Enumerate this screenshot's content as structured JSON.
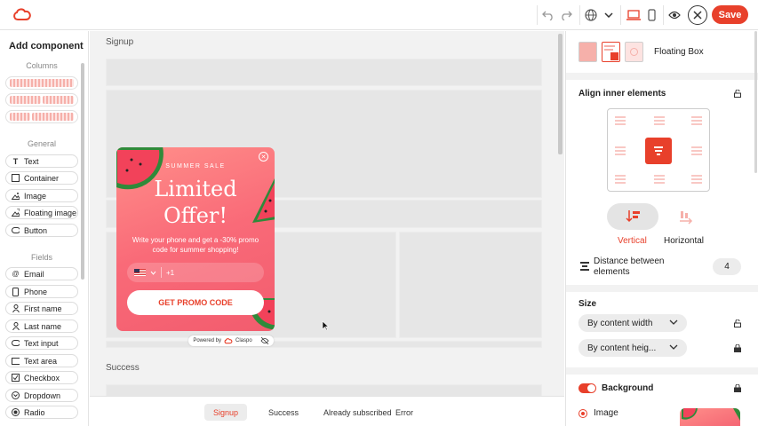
{
  "sidebar": {
    "title": "Add component",
    "sections": {
      "columns": "Columns",
      "general": "General",
      "fields": "Fields"
    },
    "general_items": [
      {
        "label": "Text",
        "icon": "text-icon"
      },
      {
        "label": "Container",
        "icon": "container-icon"
      },
      {
        "label": "Image",
        "icon": "image-icon"
      },
      {
        "label": "Floating image",
        "icon": "floating-image-icon"
      },
      {
        "label": "Button",
        "icon": "button-icon"
      }
    ],
    "field_items": [
      {
        "label": "Email",
        "icon": "at-icon"
      },
      {
        "label": "Phone",
        "icon": "phone-icon"
      },
      {
        "label": "First name",
        "icon": "person-icon"
      },
      {
        "label": "Last name",
        "icon": "person-icon"
      },
      {
        "label": "Text input",
        "icon": "input-icon"
      },
      {
        "label": "Text area",
        "icon": "textarea-icon"
      },
      {
        "label": "Checkbox",
        "icon": "checkbox-icon"
      },
      {
        "label": "Dropdown",
        "icon": "dropdown-icon"
      },
      {
        "label": "Radio",
        "icon": "radio-icon"
      }
    ]
  },
  "canvas": {
    "signup_label": "Signup",
    "success_label": "Success"
  },
  "popup": {
    "subtitle": "SUMMER SALE",
    "title_line1": "Limited",
    "title_line2": "Offer!",
    "description": "Write your phone and get a -30% promo code for summer shopping!",
    "phone_prefix": "+1",
    "button": "GET PROMO CODE",
    "powered_by": "Powered by",
    "brand": "Claspo"
  },
  "bottom_tabs": [
    {
      "label": "Signup",
      "active": true
    },
    {
      "label": "Success",
      "active": false
    },
    {
      "label": "Already subscribed",
      "active": false
    },
    {
      "label": "Error",
      "active": false
    }
  ],
  "topbar": {
    "save": "Save"
  },
  "panel": {
    "layout_type": "Floating Box",
    "align_title": "Align inner elements",
    "vertical": "Vertical",
    "horizontal": "Horizontal",
    "distance_label": "Distance between elements",
    "distance_value": "4",
    "size_title": "Size",
    "width_option": "By content width",
    "height_option": "By content heig...",
    "background_title": "Background",
    "image_option": "Image"
  },
  "colors": {
    "accent": "#e8402b",
    "popup": "#f96a78"
  }
}
